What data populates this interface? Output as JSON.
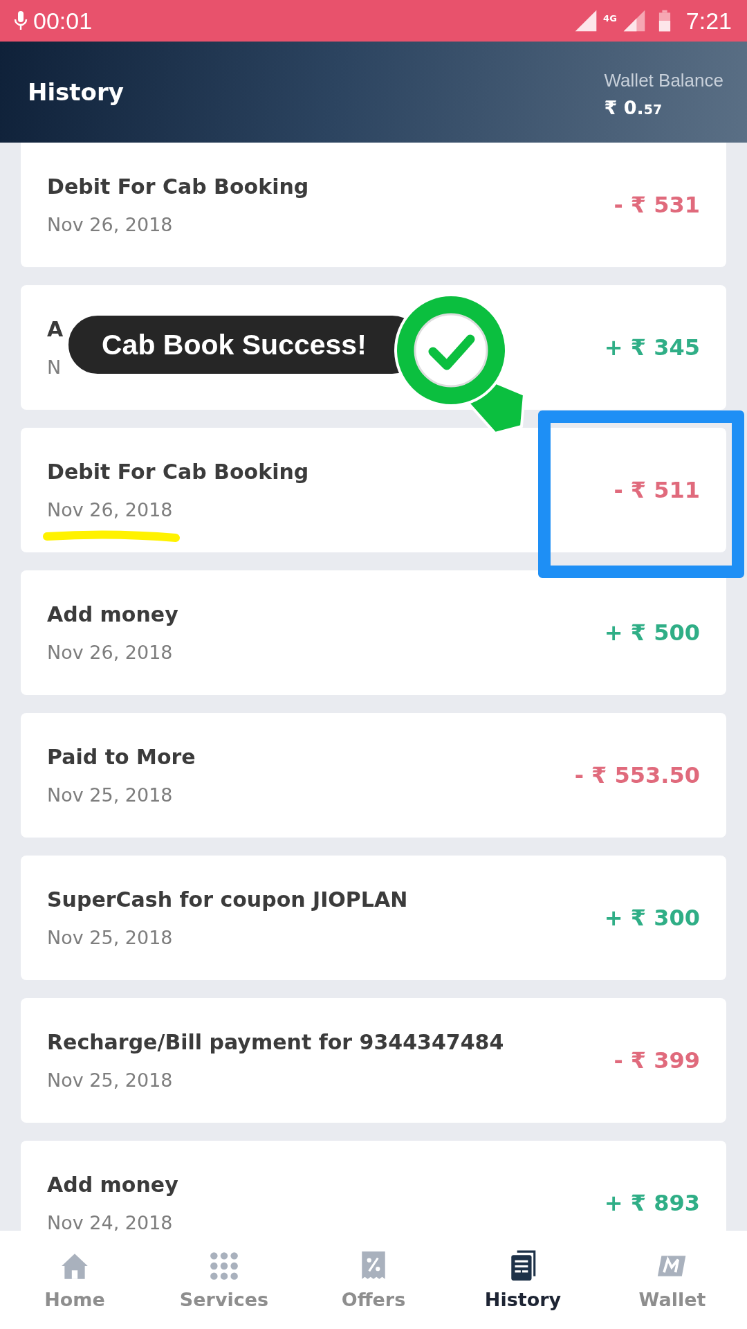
{
  "status_bar": {
    "recording_time": "00:01",
    "network": "4G",
    "time": "7:21"
  },
  "header": {
    "title": "History",
    "wallet_label": "Wallet Balance",
    "wallet_currency": "₹",
    "wallet_whole": "0.",
    "wallet_fraction": "57"
  },
  "transactions": [
    {
      "title": "Debit For Cab Booking",
      "date": "Nov 26, 2018",
      "amount": "- ₹ 531",
      "kind": "debit"
    },
    {
      "title": "A",
      "date": "N",
      "amount": "+ ₹ 345",
      "kind": "credit"
    },
    {
      "title": "Debit For Cab Booking",
      "date": "Nov 26, 2018",
      "amount": "- ₹ 511",
      "kind": "debit"
    },
    {
      "title": "Add money",
      "date": "Nov 26, 2018",
      "amount": "+ ₹ 500",
      "kind": "credit"
    },
    {
      "title": "Paid to More",
      "date": "Nov 25, 2018",
      "amount": "- ₹ 553.50",
      "kind": "debit"
    },
    {
      "title": "SuperCash for coupon JIOPLAN",
      "date": "Nov 25, 2018",
      "amount": "+ ₹ 300",
      "kind": "credit"
    },
    {
      "title": "Recharge/Bill payment for 9344347484",
      "date": "Nov 25, 2018",
      "amount": "- ₹ 399",
      "kind": "debit"
    },
    {
      "title": "Add money",
      "date": "Nov 24, 2018",
      "amount": "+ ₹ 893",
      "kind": "credit"
    }
  ],
  "toast": {
    "message": "Cab Book Success!"
  },
  "bottom_nav": [
    {
      "label": "Home",
      "kind": "home",
      "selected": false
    },
    {
      "label": "Services",
      "kind": "services",
      "selected": false
    },
    {
      "label": "Offers",
      "kind": "offers",
      "selected": false
    },
    {
      "label": "History",
      "kind": "history",
      "selected": true
    },
    {
      "label": "Wallet",
      "kind": "wallet",
      "selected": false
    }
  ]
}
